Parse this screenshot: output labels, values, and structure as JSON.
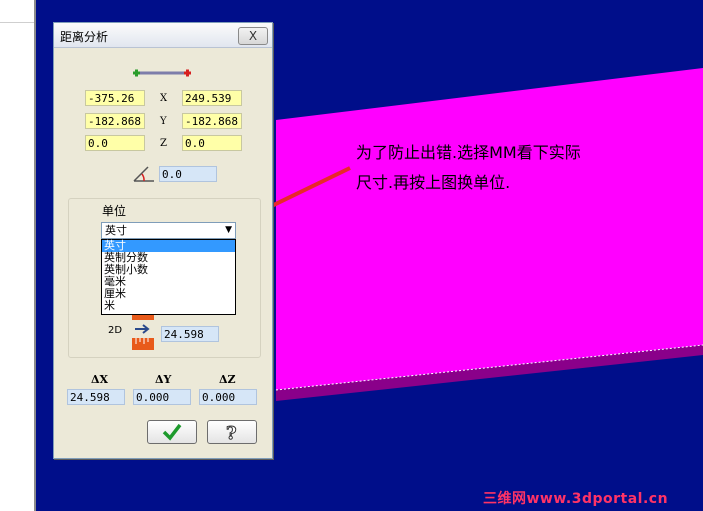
{
  "dialog": {
    "title": "距离分析",
    "close_label": "X",
    "point1": {
      "x": "-375.26",
      "y": "-182.868",
      "z": "0.0"
    },
    "point2": {
      "x": "249.539",
      "y": "-182.868",
      "z": "0.0"
    },
    "axis_labels": {
      "x": "X",
      "y": "Y",
      "z": "Z"
    },
    "angle_value": "0.0",
    "units": {
      "group_label": "单位",
      "selected": "英寸",
      "options": [
        "英寸",
        "英制分数",
        "英制小数",
        "毫米",
        "厘米",
        "米"
      ]
    },
    "distance_2d_label": "2D",
    "distance_2d_value": "24.598",
    "delta_labels": {
      "x": "ΔX",
      "y": "ΔY",
      "z": "ΔZ"
    },
    "delta_values": {
      "x": "24.598",
      "y": "0.000",
      "z": "0.000"
    },
    "ok_icon": "checkmark-icon",
    "help_icon": "question-icon"
  },
  "annotation": {
    "line1": "为了防止出错.选择MM看下实际",
    "line2": "尺寸.再按上图换单位."
  },
  "watermark": "三维网www.3dportal.cn",
  "colors": {
    "background": "#000e8a",
    "slab": "#ff00ff",
    "arrow": "#e8282a",
    "watermark": "#ff3366"
  }
}
